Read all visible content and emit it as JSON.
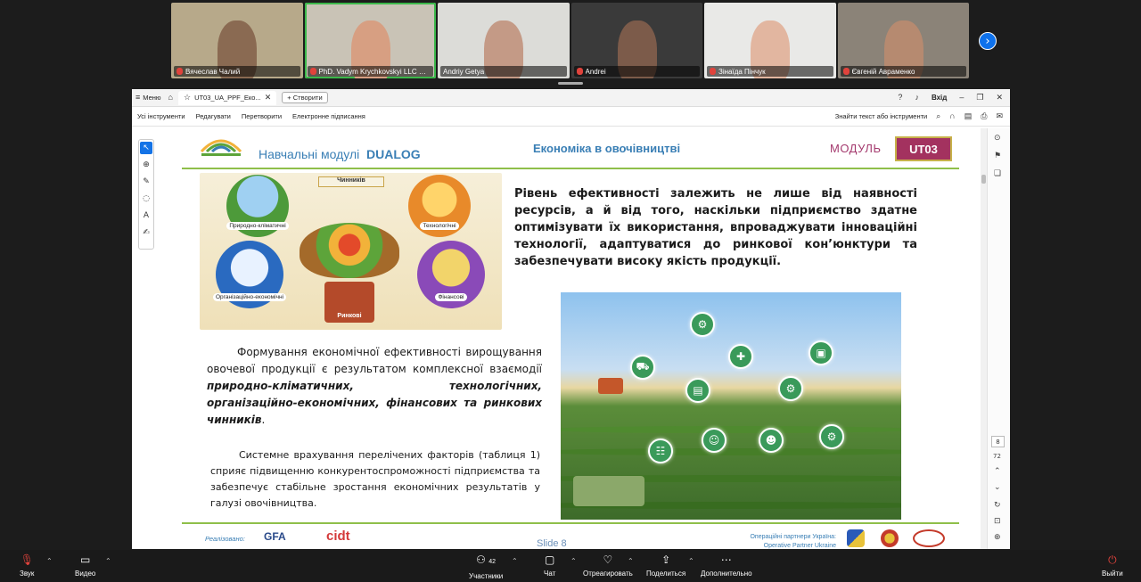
{
  "participants": [
    {
      "name": "Вячеслав Чалий",
      "muted": true,
      "bg": "#b7a98a",
      "face": "#8a6a52"
    },
    {
      "name": "PhD. Vadym Krychkovskyi LLC Orga...",
      "muted": true,
      "bg": "#c9c3b6",
      "face": "#d79f82",
      "active": true
    },
    {
      "name": "Andriy Getya",
      "muted": false,
      "bg": "#dcdcd8",
      "face": "#c49a86"
    },
    {
      "name": "Andrei",
      "muted": true,
      "bg": "#3a3a3a",
      "face": "#7c5b4a"
    },
    {
      "name": "Зінаїда Пінчук",
      "muted": true,
      "bg": "#e9e9e7",
      "face": "#e2b6a0"
    },
    {
      "name": "Євгеній Авраменко",
      "muted": true,
      "bg": "#8b8378",
      "face": "#b68a70"
    }
  ],
  "acrobat": {
    "menu_label": "Меню",
    "tab_title": "UT03_UA_PPF_Еко...",
    "new_tab_label": "+ Створити",
    "login_label": "Вхід",
    "toolbar": [
      "Усі інструменти",
      "Редагувати",
      "Перетворити",
      "Електронне підписання"
    ],
    "search_placeholder": "Знайти текст або інструменти",
    "page_current": "8",
    "page_total": "72"
  },
  "slide": {
    "logo_text": "DUALOG",
    "header_prefix": "Навчальні модулі",
    "header_brand": "DUALOG",
    "header_center": "Економіка в овочівництві",
    "module_label": "МОДУЛЬ",
    "module_code": "UT03",
    "infographic": {
      "banner": "Чинників",
      "climate": "Природно-кліматичні",
      "tech": "Технологічні",
      "org": "Організаційно-економічні",
      "fin": "Фінансові",
      "market": "Ринкові"
    },
    "para1": "Рівень ефективності залежить не лише від наявності ресурсів, а й від того, наскільки підприємство здатне оптимізувати їх використання, впроваджувати інноваційні технології, адаптуватися до ринкової кон’юнктури та забезпечувати високу якість продукції.",
    "para2_plain": "Формування економічної ефективності вирощування овочевої продукції є результатом комплексної взаємодії ",
    "para2_bold": "природно-кліматичних, технологічних, організаційно-економічних, фінансових та ринкових чинників",
    "para2_end": ".",
    "para3": "Системне врахування перелічених факторів (таблиця 1) сприяє підвищенню конкурентоспроможності підприємства та забезпечує стабільне зростання економічних результатів у галузі овочівництва.",
    "footer": {
      "implemented": "Реалізовано:",
      "gfa": "GFA",
      "cidt": "cidt",
      "slide_no": "Slide 8",
      "partners_line1": "Операційні партнери Україна:",
      "partners_line2": "Operative Partner Ukraine"
    }
  },
  "bottom_bar": {
    "audio": "Звук",
    "video": "Видео",
    "participants": "Участники",
    "participants_count": "42",
    "chat": "Чат",
    "react": "Отреагировать",
    "share": "Поделиться",
    "more": "Дополнительно",
    "leave": "Выйти"
  },
  "colors": {
    "accent_green": "#8fbf4a",
    "title_blue": "#3a7fb5",
    "module_magenta": "#a3325f",
    "zoom_blue": "#0e71eb"
  }
}
